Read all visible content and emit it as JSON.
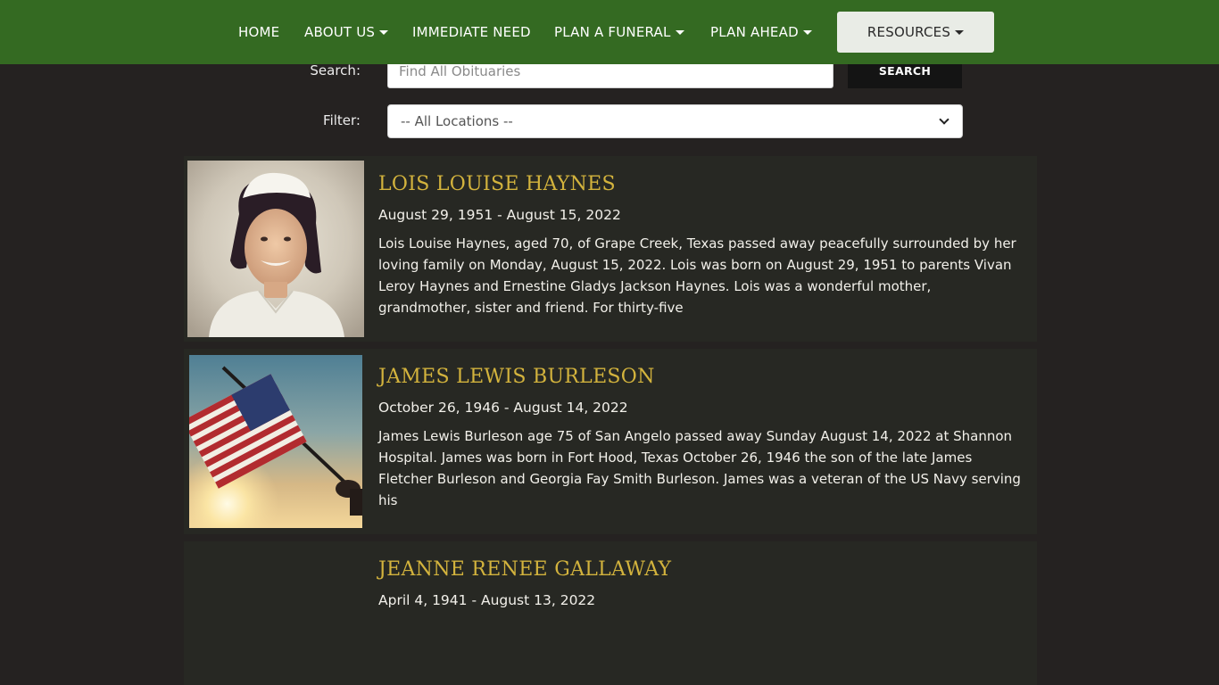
{
  "nav": {
    "items": [
      {
        "label": "HOME",
        "dropdown": false
      },
      {
        "label": "ABOUT US",
        "dropdown": true
      },
      {
        "label": "IMMEDIATE NEED",
        "dropdown": false
      },
      {
        "label": "PLAN A FUNERAL",
        "dropdown": true
      },
      {
        "label": "PLAN AHEAD",
        "dropdown": true
      }
    ],
    "resources_label": "RESOURCES"
  },
  "search": {
    "label": "Search:",
    "placeholder": "Find All Obituaries",
    "button_label": "SEARCH"
  },
  "filter": {
    "label": "Filter:",
    "selected": "-- All Locations --"
  },
  "obituaries": [
    {
      "name": "LOIS LOUISE HAYNES",
      "dates": "August 29, 1951 - August 15, 2022",
      "excerpt": "Lois Louise Haynes, aged 70, of Grape Creek, Texas passed away peacefully surrounded by her loving family on Monday, August 15, 2022. Lois was born on August 29, 1951 to parents Vivan Leroy Haynes and Ernestine Gladys Jackson Haynes. Lois was a wonderful mother, grandmother, sister and friend. For thirty-five",
      "photo": "portrait-photo"
    },
    {
      "name": "JAMES LEWIS BURLESON",
      "dates": "October 26, 1946 - August 14, 2022",
      "excerpt": "James Lewis Burleson age 75 of San Angelo passed away Sunday August 14, 2022 at Shannon Hospital. James was born in Fort Hood, Texas October 26, 1946 the son of the late James Fletcher Burleson and Georgia Fay Smith Burleson. James was a veteran of the US Navy serving his",
      "photo": "american-flag-photo"
    },
    {
      "name": "JEANNE RENEE GALLAWAY",
      "dates": "April 4, 1941 - August 13, 2022",
      "excerpt": "",
      "photo": ""
    }
  ],
  "colors": {
    "nav_bg": "#346a22",
    "page_bg": "#252221",
    "card_bg": "#272823",
    "name_gold": "#d3b33d"
  }
}
